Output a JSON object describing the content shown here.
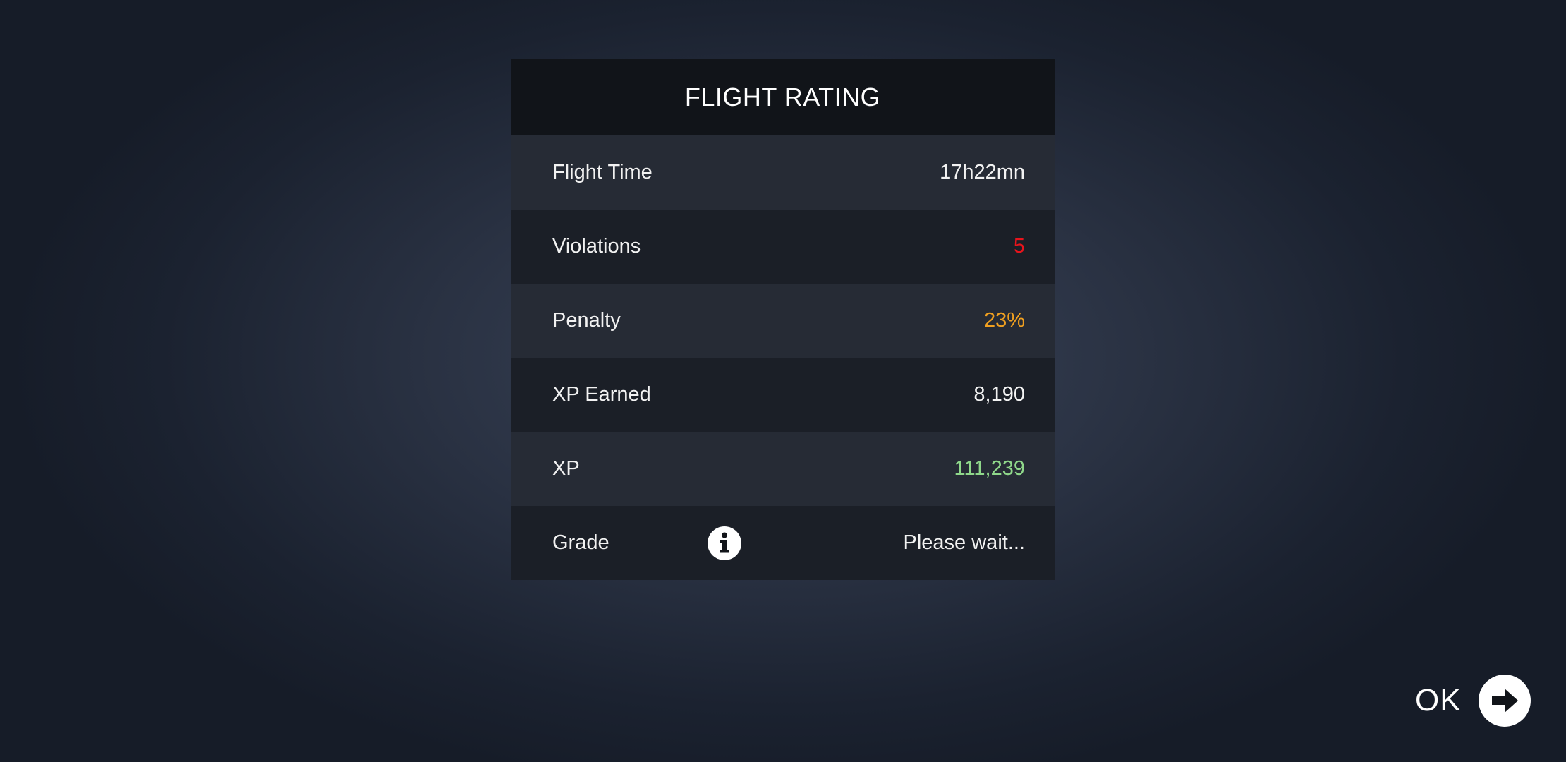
{
  "panel": {
    "title": "FLIGHT RATING",
    "rows": [
      {
        "label": "Flight Time",
        "value": "17h22mn",
        "value_color": "#f2f2f2"
      },
      {
        "label": "Violations",
        "value": "5",
        "value_color": "#e8141c"
      },
      {
        "label": "Penalty",
        "value": "23%",
        "value_color": "#f0a020"
      },
      {
        "label": "XP Earned",
        "value": "8,190",
        "value_color": "#f2f2f2"
      },
      {
        "label": "XP",
        "value": "111,239",
        "value_color": "#8fd88a"
      },
      {
        "label": "Grade",
        "value": "Please wait...",
        "value_color": "#f2f2f2",
        "icon": "info-icon"
      }
    ]
  },
  "footer": {
    "ok_label": "OK",
    "ok_icon": "arrow-right-circle-icon"
  }
}
